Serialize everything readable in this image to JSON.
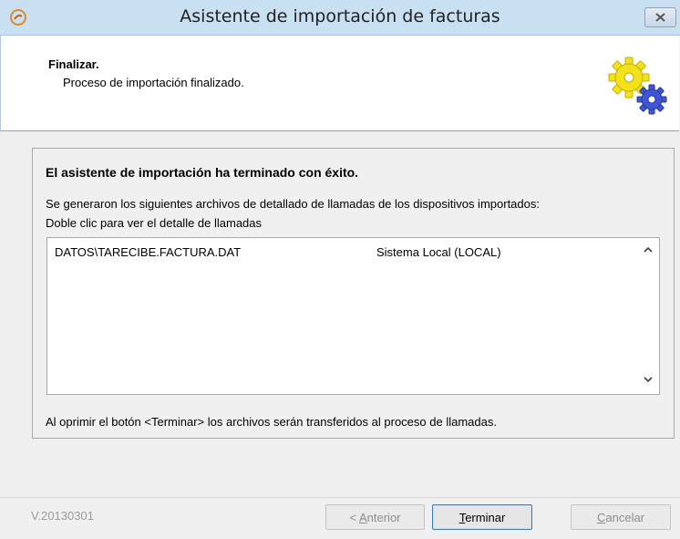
{
  "window": {
    "title": "Asistente de importación de facturas"
  },
  "header": {
    "title": "Finalizar.",
    "subtitle": "Proceso de importación finalizado."
  },
  "content": {
    "heading": "El asistente de importación ha terminado con éxito.",
    "description": "Se generaron los siguientes archivos de detallado de llamadas de los dispositivos importados:",
    "hint": "Doble clic para ver el detalle de llamadas",
    "files": [
      {
        "path": "DATOS\\TARECIBE.FACTURA.DAT",
        "system": "Sistema Local (LOCAL)"
      }
    ],
    "footer_note": "Al oprimir el botón <Terminar> los archivos serán transferidos al proceso de llamadas."
  },
  "footer": {
    "version": "V.20130301",
    "back": {
      "accel": "A",
      "rest": "nterior",
      "prefix": "< "
    },
    "finish": {
      "accel": "T",
      "rest": "erminar"
    },
    "cancel": {
      "accel": "C",
      "rest": "ancelar"
    }
  },
  "icons": {
    "app": "app-icon",
    "close": "close-icon",
    "gears": "gears-icon",
    "scroll_up": "chevron-up-icon",
    "scroll_down": "chevron-down-icon"
  },
  "colors": {
    "titlebar": "#c9dff2",
    "gear_yellow": "#f3e11b",
    "gear_blue": "#3e56d6"
  }
}
